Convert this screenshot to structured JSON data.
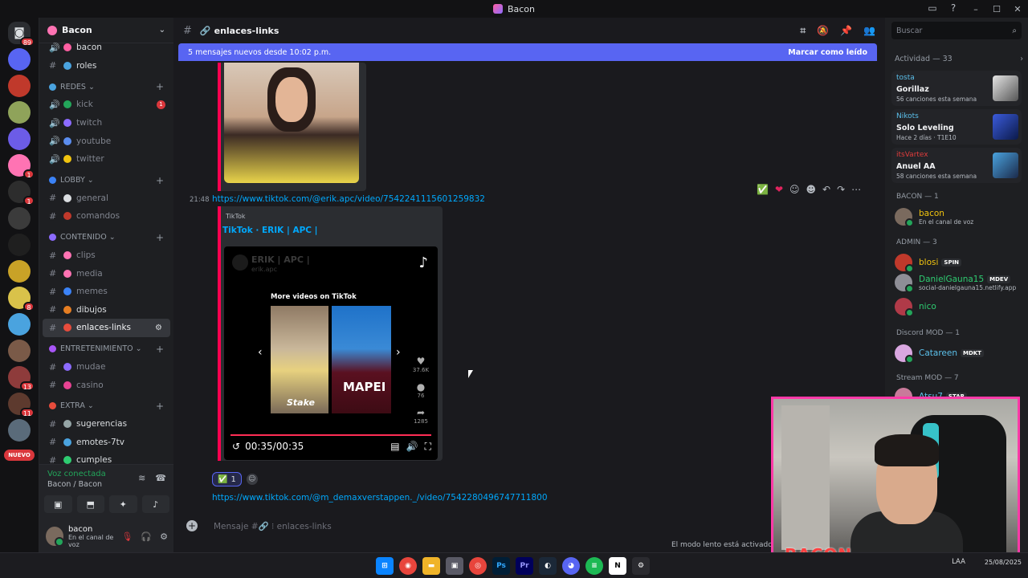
{
  "window": {
    "title": "Bacon"
  },
  "server": {
    "name": "Bacon",
    "rail_badges": [
      "89",
      "1",
      "1",
      "8",
      "13",
      "11"
    ],
    "new_label": "NUEVO"
  },
  "channels": [
    {
      "type": "channel",
      "label": "bacon",
      "kind": "voice",
      "bright": true
    },
    {
      "type": "channel",
      "label": "roles",
      "kind": "text",
      "bright": true
    },
    {
      "type": "category",
      "label": "REDES"
    },
    {
      "type": "channel",
      "label": "kick",
      "kind": "voice",
      "badge": "1"
    },
    {
      "type": "channel",
      "label": "twitch",
      "kind": "voice"
    },
    {
      "type": "channel",
      "label": "youtube",
      "kind": "voice"
    },
    {
      "type": "channel",
      "label": "twitter",
      "kind": "voice"
    },
    {
      "type": "category",
      "label": "LOBBY"
    },
    {
      "type": "channel",
      "label": "general",
      "kind": "text"
    },
    {
      "type": "channel",
      "label": "comandos",
      "kind": "text"
    },
    {
      "type": "category",
      "label": "CONTENIDO"
    },
    {
      "type": "channel",
      "label": "clips",
      "kind": "text"
    },
    {
      "type": "channel",
      "label": "media",
      "kind": "text"
    },
    {
      "type": "channel",
      "label": "memes",
      "kind": "text"
    },
    {
      "type": "channel",
      "label": "dibujos",
      "kind": "text",
      "bright": true
    },
    {
      "type": "channel",
      "label": "enlaces-links",
      "kind": "text",
      "active": true
    },
    {
      "type": "category",
      "label": "ENTRETENIMIENTO"
    },
    {
      "type": "channel",
      "label": "mudae",
      "kind": "text"
    },
    {
      "type": "channel",
      "label": "casino",
      "kind": "text"
    },
    {
      "type": "category",
      "label": "EXTRA"
    },
    {
      "type": "channel",
      "label": "sugerencias",
      "kind": "text",
      "bright": true
    },
    {
      "type": "channel",
      "label": "emotes-7tv",
      "kind": "text",
      "bright": true
    },
    {
      "type": "channel",
      "label": "cumples",
      "kind": "text",
      "bright": true
    }
  ],
  "voice": {
    "status": "Voz conectada",
    "channel": "Bacon / Bacon",
    "user": "bacon",
    "user_status": "En el canal de voz"
  },
  "chat": {
    "channel_name": "enlaces-links",
    "new_messages": "5 mensajes nuevos desde 10:02 p.m.",
    "mark_read": "Marcar como leído",
    "time": "21:48",
    "link1": "https://www.tiktok.com/@erik.apc/video/7542241115601259832",
    "embed_provider": "TikTok",
    "embed_title": "TikTok · ERIK | APC |",
    "tiktok": {
      "user": "ERIK | APC |",
      "handle": "erik.apc",
      "more": "More videos on TikTok",
      "shirt_text": "MAPEI",
      "stake": "Stake",
      "likes": "37.6K",
      "comments": "76",
      "shares": "1285",
      "time": "00:35/00:35"
    },
    "reaction_count": "1",
    "link2": "https://www.tiktok.com/@m_demaxverstappen._/video/7542280496747711800",
    "composer_placeholder": "Mensaje #🔗 ⁝ enlaces-links",
    "slow_mode": "El modo lento está activado, pe"
  },
  "members": {
    "search_placeholder": "Buscar",
    "activity_header": "Actividad — 33",
    "activities": [
      {
        "name": "tosta",
        "name_color": "#5bc0eb",
        "title": "Gorillaz",
        "sub": "56 canciones esta semana"
      },
      {
        "name": "Nikots",
        "name_color": "#5bc0eb",
        "title": "Solo Leveling",
        "sub": "Hace 2 días · T1E10"
      },
      {
        "name": "itsVartex",
        "name_color": "#e03c3c",
        "title": "Anuel AA",
        "sub": "58 canciones esta semana"
      }
    ],
    "groups": [
      {
        "label": "BACON — 1",
        "members": [
          {
            "name": "bacon",
            "color": "#f1c40f",
            "sub": "En el canal de voz"
          }
        ]
      },
      {
        "label": "ADMIN — 3",
        "members": [
          {
            "name": "blosi",
            "color": "#f1c40f",
            "tag": "SPIN"
          },
          {
            "name": "DanielGauna15",
            "color": "#2ecc71",
            "tag": "MDEV",
            "sub": "social-danielgauna15.netlify.app"
          },
          {
            "name": "nico",
            "color": "#2ecc71"
          }
        ]
      },
      {
        "label": "Discord MOD — 1",
        "members": [
          {
            "name": "Catareen",
            "color": "#5bc0eb",
            "tag": "MDKT"
          }
        ]
      },
      {
        "label": "Stream MOD — 7",
        "members": [
          {
            "name": "Atsu7",
            "color": "#5bc0eb",
            "tag": "STAR"
          }
        ]
      }
    ]
  },
  "webcam": {
    "brand": "BACON"
  },
  "taskbar": {
    "lang": "LAA",
    "date": "25/08/2025"
  }
}
